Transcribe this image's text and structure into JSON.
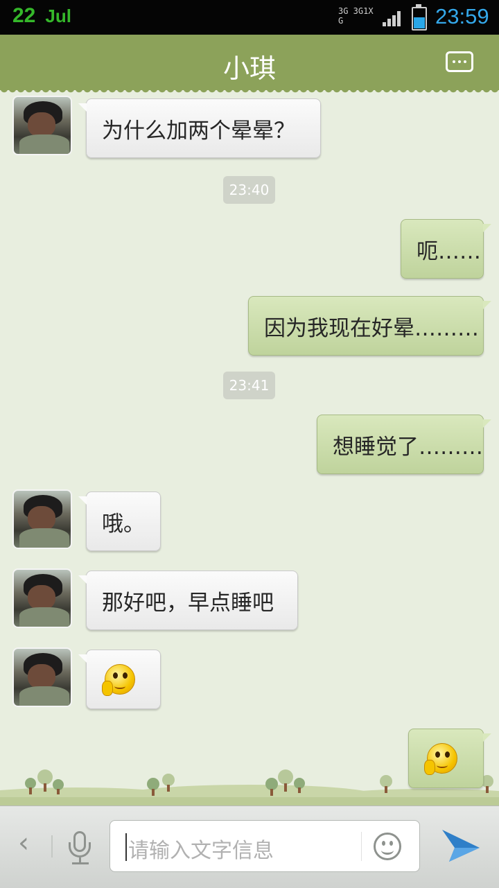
{
  "status_bar": {
    "day": "22",
    "month": "Jul",
    "network_1": "3G 3G1X",
    "network_2": "G",
    "time": "23:59",
    "battery_percent": 55
  },
  "header": {
    "contact_name": "小琪",
    "menu_icon": "more-dots-icon"
  },
  "messages": [
    {
      "side": "left",
      "text": "为什么加两个晕晕？"
    },
    {
      "side": "center",
      "text": "23:40"
    },
    {
      "side": "right",
      "text": "呃……"
    },
    {
      "side": "right",
      "text": "因为我现在好晕………"
    },
    {
      "side": "center",
      "text": "23:41"
    },
    {
      "side": "right",
      "text": "想睡觉了………"
    },
    {
      "side": "left",
      "text": "哦。"
    },
    {
      "side": "left",
      "text": "那好吧，早点睡吧"
    },
    {
      "side": "left",
      "emoji": "thinking-face-emoji"
    },
    {
      "side": "right",
      "emoji": "thinking-face-emoji"
    }
  ],
  "input": {
    "placeholder": "请输入文字信息",
    "back_icon": "chevron-left-icon",
    "mic_icon": "microphone-icon",
    "emoji_icon": "smiley-icon",
    "send_icon": "paper-plane-icon"
  },
  "colors": {
    "header": "#8ca25a",
    "background": "#e8eedf",
    "right_bubble": "#c8dba7",
    "time_accent": "#34a8ea"
  }
}
